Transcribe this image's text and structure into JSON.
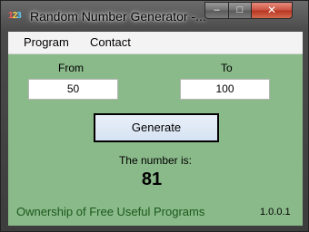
{
  "window": {
    "title": "Random Number Generator -...",
    "minimize_label": "–",
    "maximize_label": "□",
    "close_label": "✕"
  },
  "icon": {
    "app_icon": "dice-icon",
    "digit1": "1",
    "digit2": "2",
    "digit3": "3"
  },
  "menu": {
    "items": [
      {
        "label": "Program"
      },
      {
        "label": "Contact"
      }
    ]
  },
  "form": {
    "from_label": "From",
    "to_label": "To",
    "from_value": "50",
    "to_value": "100",
    "generate_label": "Generate"
  },
  "result": {
    "label": "The number is:",
    "value": "81"
  },
  "footer": {
    "ownership_link": "Ownership of Free Useful Programs",
    "version": "1.0.0.1"
  },
  "colors": {
    "client_background": "#8ab98a",
    "link": "#1a5a1a",
    "close_button": "#c9523e"
  }
}
